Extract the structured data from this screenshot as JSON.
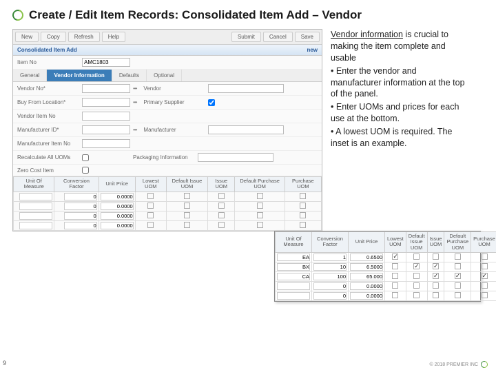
{
  "title": "Create / Edit Item Records: Consolidated Item Add – Vendor",
  "toolbar": {
    "new": "New",
    "copy": "Copy",
    "refresh": "Refresh",
    "help": "Help",
    "submit": "Submit",
    "cancel": "Cancel",
    "save": "Save"
  },
  "section": {
    "title": "Consolidated Item Add",
    "status": "new"
  },
  "itemno": {
    "label": "Item No",
    "value": "AMC1803"
  },
  "tabs": {
    "general": "General",
    "vendor": "Vendor Information",
    "defaults": "Defaults",
    "optional": "Optional"
  },
  "fields": {
    "vendorNo": {
      "label": "Vendor No*",
      "l2": "Vendor"
    },
    "buyFrom": {
      "label": "Buy From Location*",
      "l2": "Primary Supplier"
    },
    "vendorItem": {
      "label": "Vendor Item No"
    },
    "mfrId": {
      "label": "Manufacturer ID*",
      "l2": "Manufacturer"
    },
    "mfrItem": {
      "label": "Manufacturer Item No"
    },
    "recalc": {
      "label": "Recalculate All UOMs",
      "l2": "Packaging Information"
    },
    "zero": {
      "label": "Zero Cost Item"
    }
  },
  "grid": {
    "headers": [
      "Unit Of Measure",
      "Conversion Factor",
      "Unit Price",
      "Lowest UOM",
      "Default Issue UOM",
      "Issue UOM",
      "Default Purchase UOM",
      "Purchase UOM"
    ],
    "rows": [
      {
        "uom": "",
        "cf": "0",
        "up": "0.0000"
      },
      {
        "uom": "",
        "cf": "0",
        "up": "0.0000"
      },
      {
        "uom": "",
        "cf": "0",
        "up": "0.0000"
      },
      {
        "uom": "",
        "cf": "0",
        "up": "0.0000"
      }
    ]
  },
  "inset": {
    "headers": [
      "Unit Of Measure",
      "Conversion Factor",
      "Unit Price",
      "Lowest UOM",
      "Default Issue UOM",
      "Issue UOM",
      "Default Purchase UOM",
      "Purchase UOM"
    ],
    "rows": [
      {
        "uom": "EA",
        "cf": "1",
        "up": "0.6500",
        "c": [
          true,
          false,
          false,
          false,
          false
        ]
      },
      {
        "uom": "BX",
        "cf": "10",
        "up": "6.5000",
        "c": [
          false,
          true,
          true,
          false,
          false
        ]
      },
      {
        "uom": "CA",
        "cf": "100",
        "up": "65.000",
        "c": [
          false,
          false,
          true,
          true,
          true
        ]
      },
      {
        "uom": "",
        "cf": "0",
        "up": "0.0000",
        "c": [
          false,
          false,
          false,
          false,
          false
        ]
      },
      {
        "uom": "",
        "cf": "0",
        "up": "0.0000",
        "c": [
          false,
          false,
          false,
          false,
          false
        ]
      }
    ]
  },
  "explain": {
    "l1a": "Vendor information",
    "l1b": " is crucial to making the item complete and usable",
    "b1": "Enter the vendor and manufacturer information at the top of the panel.",
    "b2": "Enter UOMs and prices for each use at the bottom.",
    "b3": "A lowest UOM is required. The inset is an example."
  },
  "footer": "© 2018 PREMIER INC",
  "page": "9"
}
